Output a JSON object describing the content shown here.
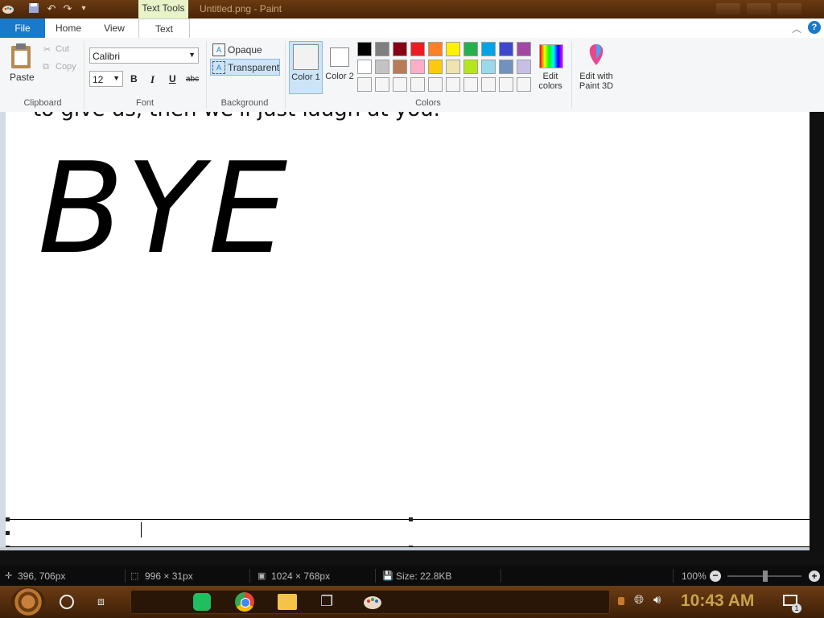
{
  "window": {
    "title": "Untitled.png - Paint",
    "contextual_tab": "Text Tools"
  },
  "tabs": {
    "file": "File",
    "home": "Home",
    "view": "View",
    "text": "Text"
  },
  "ribbon": {
    "clipboard": {
      "paste": "Paste",
      "cut": "Cut",
      "copy": "Copy",
      "label": "Clipboard"
    },
    "font": {
      "family": "Calibri",
      "size": "12",
      "bold": "B",
      "italic": "I",
      "underline": "U",
      "strike": "abc",
      "label": "Font"
    },
    "background": {
      "opaque": "Opaque",
      "transparent": "Transparent",
      "label": "Background"
    },
    "colors": {
      "color1": "Color 1",
      "color2": "Color 2",
      "label": "Colors",
      "edit_colors": "Edit colors",
      "palette_row1": [
        "#000000",
        "#7f7f7f",
        "#880015",
        "#ed1c24",
        "#ff7f27",
        "#fff200",
        "#22b14c",
        "#00a2e8",
        "#3f48cc",
        "#a349a4"
      ],
      "palette_row2": [
        "#ffffff",
        "#c3c3c3",
        "#b97a57",
        "#ffaec9",
        "#ffc90e",
        "#efe4b0",
        "#b5e61d",
        "#99d9ea",
        "#7092be",
        "#c8bfe7"
      ]
    },
    "paint3d": "Edit with Paint 3D"
  },
  "canvas": {
    "partial_text": "to give us, then we'll just laugh at you.",
    "big_text": "BYE"
  },
  "status": {
    "cursor": "396, 706px",
    "selection": "996 × 31px",
    "image_size": "1024 × 768px",
    "file_size": "Size: 22.8KB",
    "zoom": "100%"
  },
  "taskbar": {
    "time": "10:43 AM",
    "notification_count": "1"
  }
}
